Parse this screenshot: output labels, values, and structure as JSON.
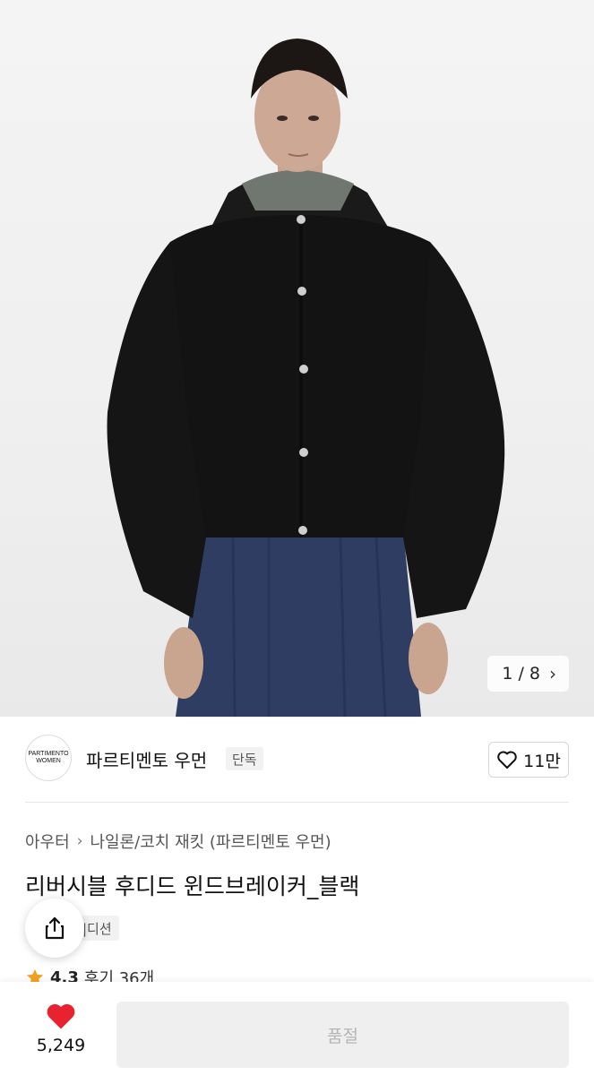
{
  "gallery": {
    "current": "1",
    "separator": "/",
    "total": "8",
    "next_icon": "chevron-right-icon"
  },
  "brand": {
    "logo_line1": "PARTIMENTO",
    "logo_line2": "WOMEN",
    "name": "파르티멘토 우먼",
    "badge": "단독",
    "like_count": "11만"
  },
  "breadcrumb": {
    "category": "아우터",
    "subcategory": "나일론/코치 재킷 (파르티멘토 우먼)"
  },
  "product": {
    "title": "리버시블 후디드 윈드브레이커_블랙",
    "tag": "|디션",
    "rating": "4.3",
    "reviews": "후기 36개"
  },
  "bottom_bar": {
    "heart_count": "5,249",
    "action_label": "품절"
  },
  "colors": {
    "heart": "#e8222f",
    "star": "#f2a01f",
    "soldout_bg": "#efefef"
  }
}
